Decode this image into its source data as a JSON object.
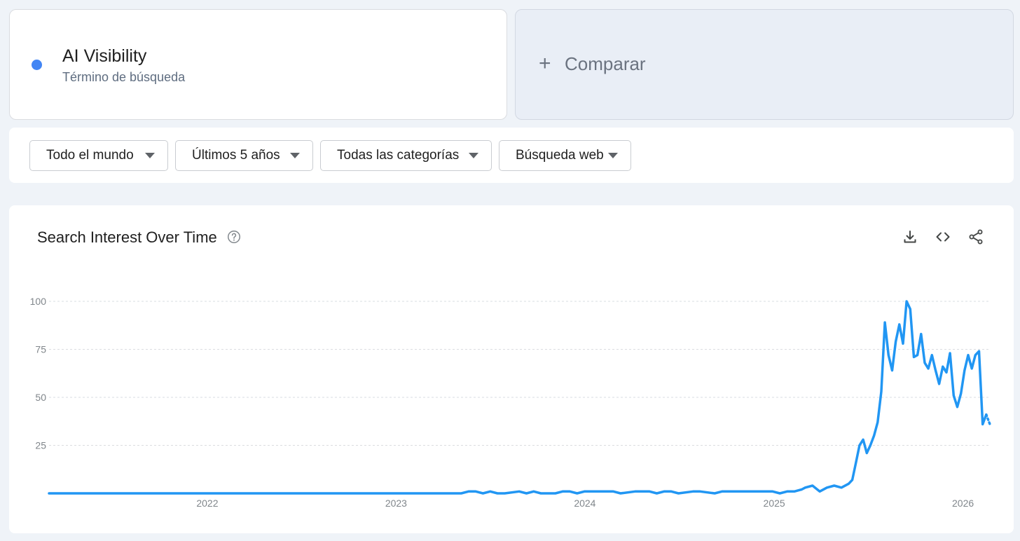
{
  "term": {
    "name": "AI Visibility",
    "subtitle": "Término de búsqueda",
    "color": "#4285f4"
  },
  "compare": {
    "plus": "+",
    "label": "Comparar"
  },
  "filters": [
    {
      "label": "Todo el mundo"
    },
    {
      "label": "Últimos 5 años"
    },
    {
      "label": "Todas las categorías"
    },
    {
      "label": "Búsqueda web"
    }
  ],
  "panel": {
    "title": "Search Interest Over Time",
    "icons": [
      "help-icon",
      "download-icon",
      "embed-code-icon",
      "share-icon"
    ]
  },
  "chart_data": {
    "type": "line",
    "title": "Search Interest Over Time",
    "xlabel": "",
    "ylabel": "",
    "ylim": [
      0,
      100
    ],
    "yticks": [
      25,
      50,
      75,
      100
    ],
    "xticks": [
      "2022",
      "2023",
      "2024",
      "2025",
      "2026"
    ],
    "xrange": [
      "2021-03-01",
      "2026-02-22"
    ],
    "grid": true,
    "line_color": "#2196f3",
    "series": [
      {
        "name": "AI Visibility",
        "x": [
          "2021-03-01",
          "2023-05-07",
          "2023-05-21",
          "2023-06-04",
          "2023-06-18",
          "2023-07-02",
          "2023-07-16",
          "2023-07-30",
          "2023-08-27",
          "2023-09-10",
          "2023-09-24",
          "2023-10-08",
          "2023-11-05",
          "2023-11-19",
          "2023-12-03",
          "2023-12-17",
          "2023-12-31",
          "2024-02-25",
          "2024-03-10",
          "2024-04-07",
          "2024-05-05",
          "2024-05-19",
          "2024-06-02",
          "2024-06-16",
          "2024-06-30",
          "2024-07-28",
          "2024-08-11",
          "2024-09-08",
          "2024-09-22",
          "2024-10-06",
          "2024-12-29",
          "2025-01-12",
          "2025-01-26",
          "2025-02-09",
          "2025-02-23",
          "2025-03-02",
          "2025-03-16",
          "2025-03-30",
          "2025-04-13",
          "2025-04-27",
          "2025-05-11",
          "2025-05-25",
          "2025-06-01",
          "2025-06-08",
          "2025-06-15",
          "2025-06-22",
          "2025-06-29",
          "2025-07-06",
          "2025-07-13",
          "2025-07-20",
          "2025-07-27",
          "2025-08-03",
          "2025-08-10",
          "2025-08-17",
          "2025-08-24",
          "2025-08-31",
          "2025-09-07",
          "2025-09-14",
          "2025-09-21",
          "2025-09-28",
          "2025-10-05",
          "2025-10-12",
          "2025-10-19",
          "2025-10-26",
          "2025-11-02",
          "2025-11-09",
          "2025-11-16",
          "2025-11-23",
          "2025-11-30",
          "2025-12-07",
          "2025-12-14",
          "2025-12-21",
          "2025-12-28",
          "2026-01-04",
          "2026-01-11",
          "2026-01-18",
          "2026-01-25",
          "2026-02-01",
          "2026-02-08",
          "2026-02-15"
        ],
        "values": [
          0,
          0,
          1,
          1,
          0,
          1,
          0,
          0,
          1,
          0,
          1,
          0,
          0,
          1,
          1,
          0,
          1,
          1,
          0,
          1,
          1,
          0,
          1,
          1,
          0,
          1,
          1,
          0,
          1,
          1,
          1,
          0,
          1,
          1,
          2,
          3,
          4,
          1,
          3,
          4,
          3,
          5,
          7,
          16,
          25,
          28,
          21,
          25,
          30,
          37,
          53,
          89,
          72,
          64,
          79,
          88,
          78,
          100,
          96,
          71,
          72,
          83,
          68,
          65,
          72,
          64,
          57,
          66,
          63,
          73,
          51,
          45,
          52,
          64,
          72,
          65,
          72,
          74,
          36,
          41
        ]
      }
    ],
    "partial_point": {
      "x": "2026-02-22",
      "value": 36
    }
  }
}
